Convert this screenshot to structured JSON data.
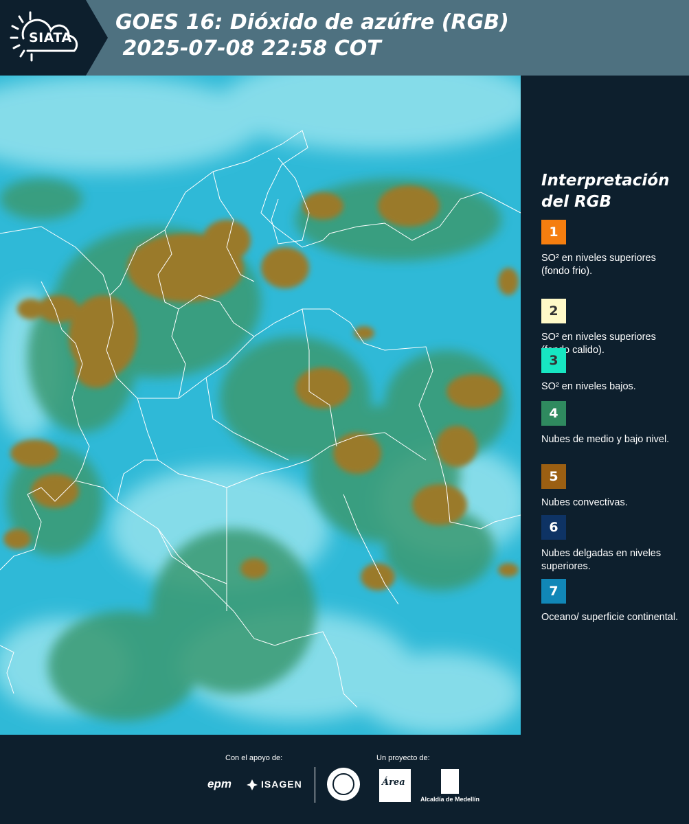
{
  "header": {
    "logo": "SIATA",
    "title": "GOES 16: Dióxido de azúfre (RGB)\n 2025-07-08 22:58 COT",
    "background": "#4e7180",
    "dark": "#0d1f2d"
  },
  "legend": {
    "title": "Interpretación del RGB",
    "items": [
      {
        "num": "1",
        "color": "#f57e0f",
        "text_color": "#ffffff",
        "text": "SO² en niveles superiores (fondo frio)."
      },
      {
        "num": "2",
        "color": "#fffac8",
        "text_color": "#333333",
        "text": "SO² en niveles superiores (fondo calido)."
      },
      {
        "num": "3",
        "color": "#17e6c2",
        "text_color": "#333333",
        "text": "SO² en niveles bajos."
      },
      {
        "num": "4",
        "color": "#2f8a5f",
        "text_color": "#ffffff",
        "text": "Nubes de medio y bajo nivel."
      },
      {
        "num": "5",
        "color": "#9b5f12",
        "text_color": "#ffffff",
        "text": "Nubes convectivas."
      },
      {
        "num": "6",
        "color": "#0e3364",
        "text_color": "#ffffff",
        "text": "Nubes delgadas en niveles superiores."
      },
      {
        "num": "7",
        "color": "#1187b7",
        "text_color": "#ffffff",
        "text": "Oceano/ superficie continental."
      }
    ]
  },
  "map": {
    "colors": {
      "ocean": "#2fb9d7",
      "haze": "#8fe0ec",
      "green": "#3a9a72",
      "convective": "#9a7a2a",
      "border": "#ffffff"
    }
  },
  "footer": {
    "support_label": "Con el apoyo de:",
    "project_label": "Un proyecto de:",
    "epm_logo": "epm",
    "isagen_logo": "ISAGEN",
    "area_logo": "Área",
    "alcaldia_logo": "Alcaldía de Medellín"
  }
}
